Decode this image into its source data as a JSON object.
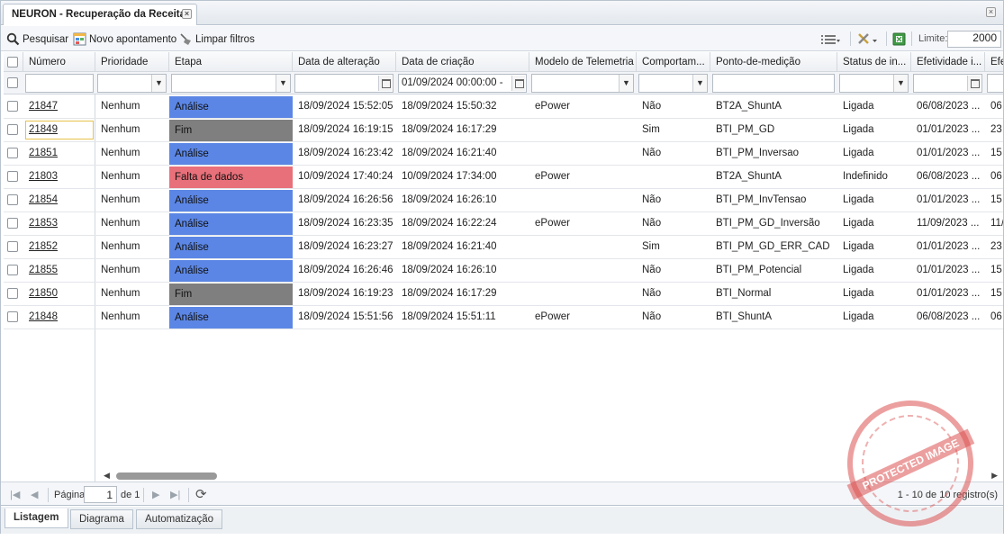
{
  "tab": {
    "title": "NEURON - Recuperação da Receita"
  },
  "toolbar": {
    "search_label": "Pesquisar",
    "new_label": "Novo apontamento",
    "clear_label": "Limpar filtros",
    "limit_label": "Limite:",
    "limit_value": "2000"
  },
  "columns": [
    "Número",
    "Prioridade",
    "Etapa",
    "Data de alteração",
    "Data de criação",
    "Modelo de Telemetria",
    "Comportam...",
    "Ponto-de-medição",
    "Status de in...",
    "Efetividade i...",
    "Efe"
  ],
  "filters": {
    "creation_date": "01/09/2024 00:00:00 -"
  },
  "stage_colors": {
    "Análise": "#5b86e5",
    "Fim": "#7f7f7f",
    "Falta de dados": "#e8707a"
  },
  "rows": [
    {
      "numero": "21847",
      "prioridade": "Nenhum",
      "etapa": "Análise",
      "alteracao": "18/09/2024 15:52:05",
      "criacao": "18/09/2024 15:50:32",
      "modelo": "ePower",
      "comport": "Não",
      "ponto": "BT2A_ShuntA",
      "status": "Ligada",
      "efet": "06/08/2023 ...",
      "efe2": "06"
    },
    {
      "numero": "21849",
      "prioridade": "Nenhum",
      "etapa": "Fim",
      "alteracao": "18/09/2024 16:19:15",
      "criacao": "18/09/2024 16:17:29",
      "modelo": "",
      "comport": "Sim",
      "ponto": "BTI_PM_GD",
      "status": "Ligada",
      "efet": "01/01/2023 ...",
      "efe2": "23"
    },
    {
      "numero": "21851",
      "prioridade": "Nenhum",
      "etapa": "Análise",
      "alteracao": "18/09/2024 16:23:42",
      "criacao": "18/09/2024 16:21:40",
      "modelo": "",
      "comport": "Não",
      "ponto": "BTI_PM_Inversao",
      "status": "Ligada",
      "efet": "01/01/2023 ...",
      "efe2": "15"
    },
    {
      "numero": "21803",
      "prioridade": "Nenhum",
      "etapa": "Falta de dados",
      "alteracao": "10/09/2024 17:40:24",
      "criacao": "10/09/2024 17:34:00",
      "modelo": "ePower",
      "comport": "",
      "ponto": "BT2A_ShuntA",
      "status": "Indefinido",
      "efet": "06/08/2023 ...",
      "efe2": "06"
    },
    {
      "numero": "21854",
      "prioridade": "Nenhum",
      "etapa": "Análise",
      "alteracao": "18/09/2024 16:26:56",
      "criacao": "18/09/2024 16:26:10",
      "modelo": "",
      "comport": "Não",
      "ponto": "BTI_PM_InvTensao",
      "status": "Ligada",
      "efet": "01/01/2023 ...",
      "efe2": "15"
    },
    {
      "numero": "21853",
      "prioridade": "Nenhum",
      "etapa": "Análise",
      "alteracao": "18/09/2024 16:23:35",
      "criacao": "18/09/2024 16:22:24",
      "modelo": "ePower",
      "comport": "Não",
      "ponto": "BTI_PM_GD_Inversão",
      "status": "Ligada",
      "efet": "11/09/2023 ...",
      "efe2": "11/"
    },
    {
      "numero": "21852",
      "prioridade": "Nenhum",
      "etapa": "Análise",
      "alteracao": "18/09/2024 16:23:27",
      "criacao": "18/09/2024 16:21:40",
      "modelo": "",
      "comport": "Sim",
      "ponto": "BTI_PM_GD_ERR_CAD",
      "status": "Ligada",
      "efet": "01/01/2023 ...",
      "efe2": "23"
    },
    {
      "numero": "21855",
      "prioridade": "Nenhum",
      "etapa": "Análise",
      "alteracao": "18/09/2024 16:26:46",
      "criacao": "18/09/2024 16:26:10",
      "modelo": "",
      "comport": "Não",
      "ponto": "BTI_PM_Potencial",
      "status": "Ligada",
      "efet": "01/01/2023 ...",
      "efe2": "15"
    },
    {
      "numero": "21850",
      "prioridade": "Nenhum",
      "etapa": "Fim",
      "alteracao": "18/09/2024 16:19:23",
      "criacao": "18/09/2024 16:17:29",
      "modelo": "",
      "comport": "Não",
      "ponto": "BTI_Normal",
      "status": "Ligada",
      "efet": "01/01/2023 ...",
      "efe2": "15"
    },
    {
      "numero": "21848",
      "prioridade": "Nenhum",
      "etapa": "Análise",
      "alteracao": "18/09/2024 15:51:56",
      "criacao": "18/09/2024 15:51:11",
      "modelo": "ePower",
      "comport": "Não",
      "ponto": "BTI_ShuntA",
      "status": "Ligada",
      "efet": "06/08/2023 ...",
      "efe2": "06"
    }
  ],
  "pager": {
    "page_label": "Página",
    "page_value": "1",
    "of_label": "de 1",
    "records": "1 - 10 de 10 registro(s)"
  },
  "bottom_tabs": [
    "Listagem",
    "Diagrama",
    "Automatização"
  ],
  "watermark": "PROTECTED IMAGE"
}
